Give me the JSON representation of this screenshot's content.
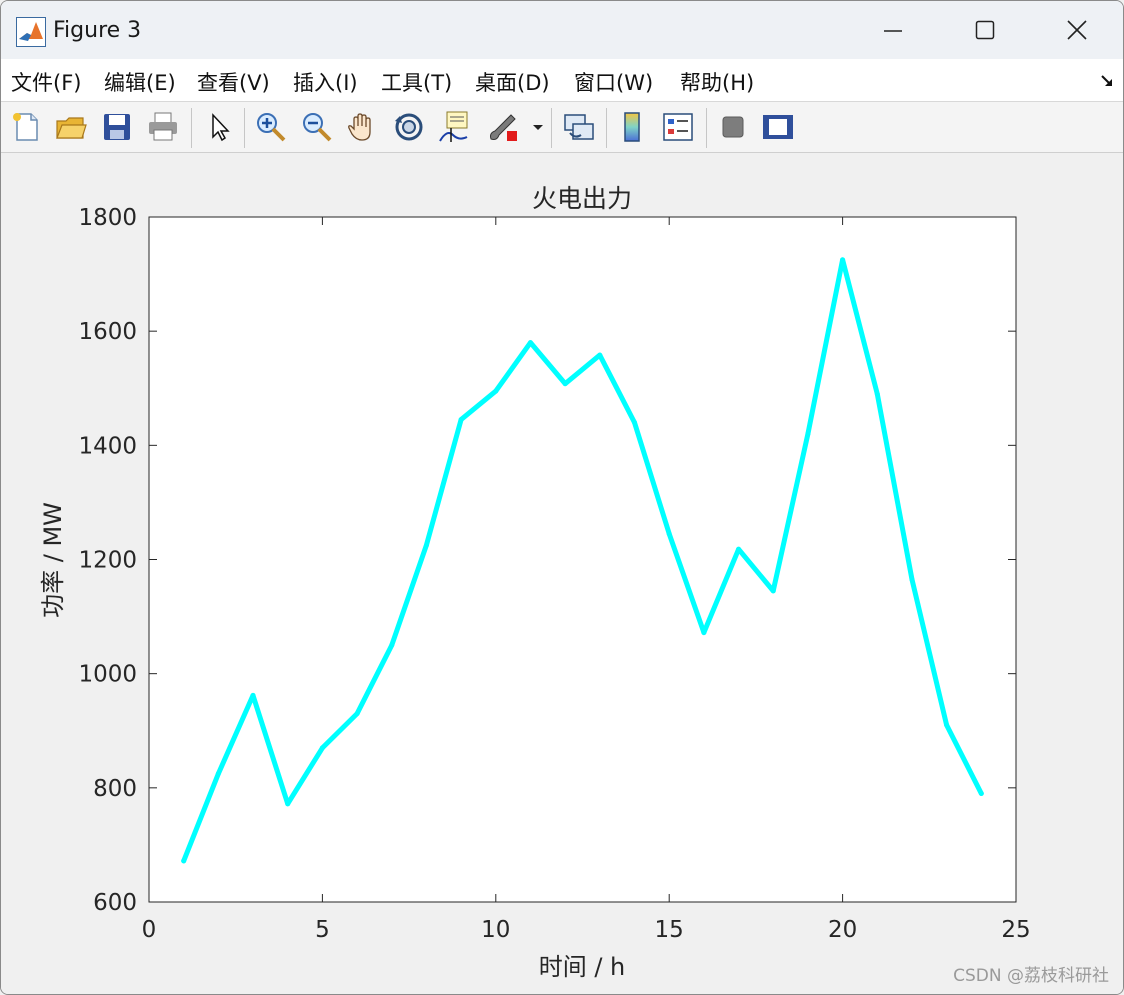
{
  "window": {
    "title": "Figure 3"
  },
  "menu": {
    "items": [
      "文件(F)",
      "编辑(E)",
      "查看(V)",
      "插入(I)",
      "工具(T)",
      "桌面(D)",
      "窗口(W)",
      "帮助(H)"
    ]
  },
  "toolbar": {
    "buttons": [
      "new-figure-icon",
      "open-folder-icon",
      "save-icon",
      "print-icon",
      "pointer-icon",
      "zoom-in-icon",
      "zoom-out-icon",
      "pan-hand-icon",
      "rotate-3d-icon",
      "data-cursor-icon",
      "brush-icon",
      "link-plot-icon",
      "colorbar-icon",
      "legend-icon",
      "hide-plot-tools-icon",
      "show-plot-tools-icon"
    ]
  },
  "chart_data": {
    "type": "line",
    "title": "火电出力",
    "xlabel": "时间 / h",
    "ylabel": "功率 / MW",
    "xlim": [
      0,
      25
    ],
    "ylim": [
      600,
      1800
    ],
    "xticks": [
      0,
      5,
      10,
      15,
      20,
      25
    ],
    "yticks": [
      600,
      800,
      1000,
      1200,
      1400,
      1600,
      1800
    ],
    "grid": false,
    "color": "#00ffff",
    "x": [
      1,
      2,
      3,
      4,
      5,
      6,
      7,
      8,
      9,
      10,
      11,
      12,
      13,
      14,
      15,
      16,
      17,
      18,
      19,
      20,
      21,
      22,
      23,
      24
    ],
    "values": [
      672,
      825,
      962,
      772,
      870,
      930,
      1050,
      1225,
      1445,
      1495,
      1580,
      1508,
      1558,
      1440,
      1245,
      1072,
      1218,
      1145,
      1420,
      1725,
      1490,
      1165,
      910,
      790
    ]
  },
  "watermark": "CSDN @荔枝科研社"
}
